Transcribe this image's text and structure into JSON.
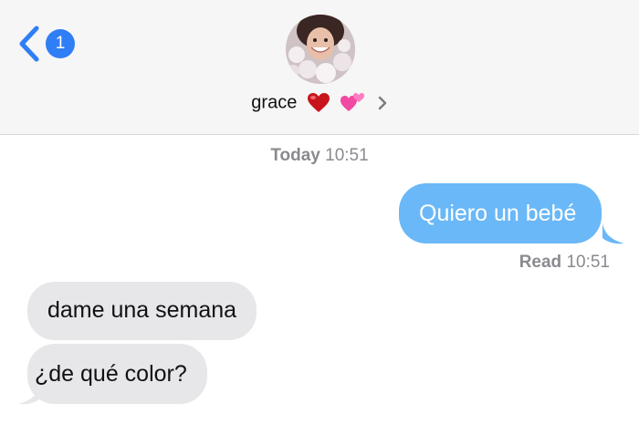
{
  "header": {
    "back_badge_count": "1",
    "contact_name": "grace"
  },
  "thread": {
    "date_label": "Today",
    "date_time": "10:51",
    "messages": [
      {
        "direction": "outgoing",
        "text": "Quiero un bebé"
      },
      {
        "direction": "incoming",
        "text": "dame una semana"
      },
      {
        "direction": "incoming",
        "text": "¿de qué color?"
      }
    ],
    "read_label": "Read",
    "read_time": "10:51"
  },
  "colors": {
    "outgoing_bubble": "#6ab8f7",
    "incoming_bubble": "#e7e7ea",
    "accent": "#2f7ef6",
    "header_bg": "#f6f6f6",
    "meta_text": "#8a8a8f"
  },
  "icons": [
    "back-chevron-icon",
    "red-heart-icon",
    "two-hearts-icon",
    "chevron-right-icon",
    "avatar"
  ]
}
